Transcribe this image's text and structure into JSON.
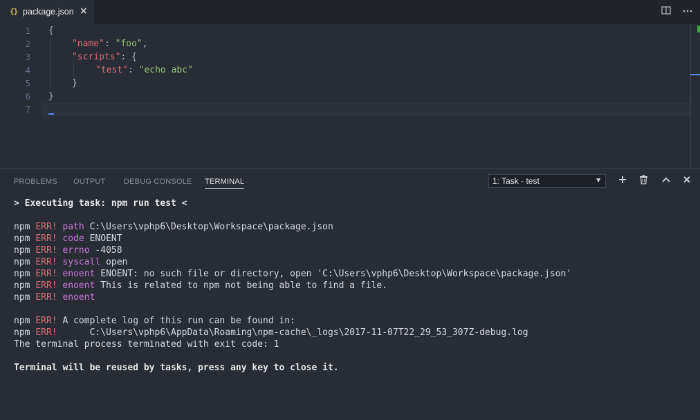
{
  "tab": {
    "icon_text": "{}",
    "label": "package.json",
    "close": "×"
  },
  "toolbar": {
    "split_icon": "split-editor-icon",
    "more_icon": "more-icon"
  },
  "editor": {
    "line_numbers": [
      "1",
      "2",
      "3",
      "4",
      "5",
      "6",
      "7"
    ],
    "lines": [
      {
        "t1": "{"
      },
      {
        "k": "\"name\"",
        "p": ": ",
        "s": "\"foo\"",
        "e": ","
      },
      {
        "k": "\"scripts\"",
        "p": ": {"
      },
      {
        "k": "\"test\"",
        "p": ": ",
        "s": "\"echo abc\""
      },
      {
        "t1": "}"
      },
      {
        "t1": "}"
      },
      {
        "t1": ""
      }
    ]
  },
  "panel": {
    "tabs": [
      "PROBLEMS",
      "OUTPUT",
      "DEBUG CONSOLE",
      "TERMINAL"
    ],
    "active_tab": "TERMINAL",
    "terminal_select": "1: Task - test",
    "actions": {
      "add": "+",
      "kill": "trash",
      "maximize": "^",
      "close": "×"
    }
  },
  "terminal": {
    "executing": "> Executing task: npm run test <",
    "npm": "npm",
    "err": "ERR!",
    "errors": [
      {
        "key": "path",
        "val": "C:\\Users\\vphp6\\Desktop\\Workspace\\package.json"
      },
      {
        "key": "code",
        "val": "ENOENT"
      },
      {
        "key": "errno",
        "val": "-4058"
      },
      {
        "key": "syscall",
        "val": "open"
      },
      {
        "key": "enoent",
        "val": "ENOENT: no such file or directory, open 'C:\\Users\\vphp6\\Desktop\\Workspace\\package.json'"
      },
      {
        "key": "enoent",
        "val": "This is related to npm not being able to find a file."
      },
      {
        "key": "enoent",
        "val": ""
      }
    ],
    "log_line1": "A complete log of this run can be found in:",
    "log_line2": "     C:\\Users\\vphp6\\AppData\\Roaming\\npm-cache\\_logs\\2017-11-07T22_29_53_307Z-debug.log",
    "exit_line": "The terminal process terminated with exit code: 1",
    "reuse_line": "Terminal will be reused by tasks, press any key to close it."
  },
  "colors": {
    "background": "#282c34",
    "tabbar": "#21252b",
    "error": "#e06c75",
    "keyword": "#c678dd",
    "string": "#98c379"
  }
}
